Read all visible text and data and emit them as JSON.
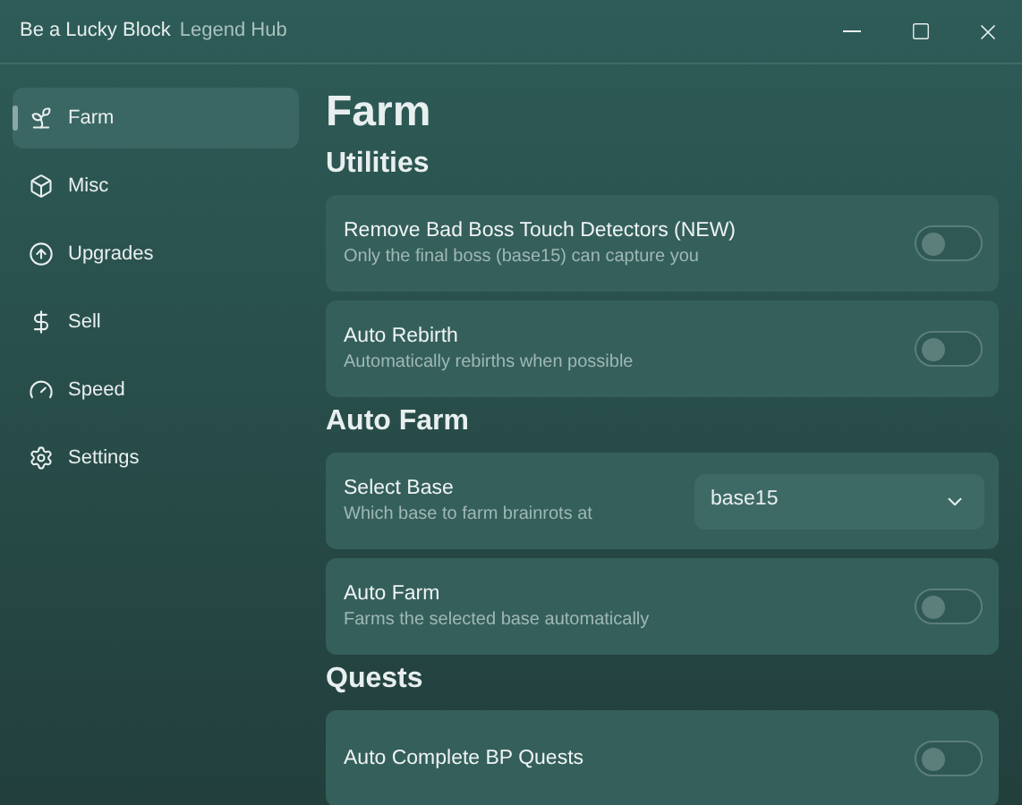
{
  "window": {
    "title": "Be a Lucky Block",
    "subtitle": "Legend Hub"
  },
  "sidebar": {
    "items": [
      {
        "label": "Farm",
        "selected": true
      },
      {
        "label": "Misc",
        "selected": false
      },
      {
        "label": "Upgrades",
        "selected": false
      },
      {
        "label": "Sell",
        "selected": false
      },
      {
        "label": "Speed",
        "selected": false
      },
      {
        "label": "Settings",
        "selected": false
      }
    ]
  },
  "page": {
    "title": "Farm",
    "sections": [
      {
        "title": "Utilities",
        "items": [
          {
            "kind": "toggle",
            "label": "Remove Bad Boss Touch Detectors (NEW)",
            "description": "Only the final boss (base15) can capture you",
            "on": false
          },
          {
            "kind": "toggle",
            "label": "Auto Rebirth",
            "description": "Automatically rebirths when possible",
            "on": false
          }
        ]
      },
      {
        "title": "Auto Farm",
        "items": [
          {
            "kind": "dropdown",
            "label": "Select Base",
            "description": "Which base to farm brainrots at",
            "value": "base15"
          },
          {
            "kind": "toggle",
            "label": "Auto Farm",
            "description": "Farms the selected base automatically",
            "on": false
          }
        ]
      },
      {
        "title": "Quests",
        "items": [
          {
            "kind": "toggle",
            "label": "Auto Complete BP Quests",
            "on": false
          }
        ]
      }
    ]
  }
}
